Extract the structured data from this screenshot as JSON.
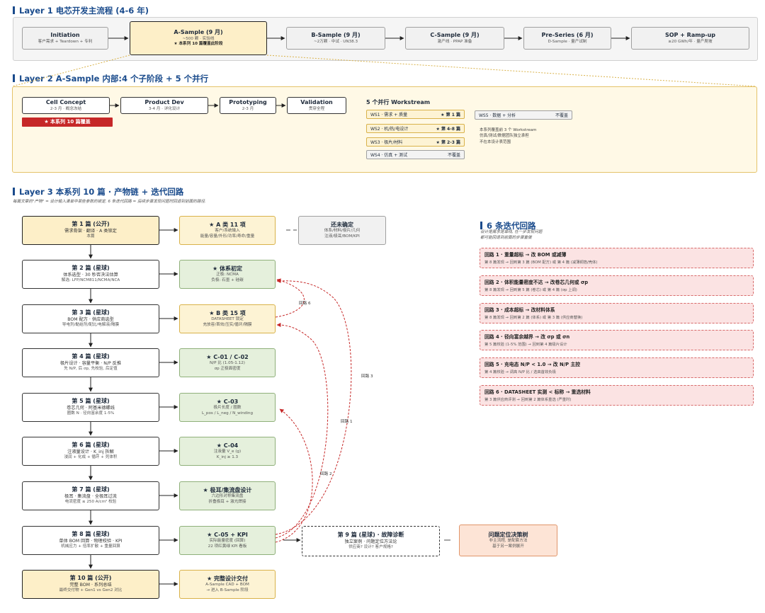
{
  "layer1": {
    "title": "Layer 1 电芯开发主流程 (4-6 年)",
    "stages": [
      {
        "title": "Initiation",
        "sub": "客户需求 + Teardown + 专利",
        "extra": ""
      },
      {
        "title": "A-Sample (9 月)",
        "sub": "~500 颗 · 实验线",
        "extra": "★ 本系列 10 篇覆盖此阶段"
      },
      {
        "title": "B-Sample (9 月)",
        "sub": "~2万颗 · 中试 · UN38.3",
        "extra": ""
      },
      {
        "title": "C-Sample (9 月)",
        "sub": "激产线 · PPAP 准备",
        "extra": ""
      },
      {
        "title": "Pre-Series (6 月)",
        "sub": "D-Sample · 量产试制",
        "extra": ""
      },
      {
        "title": "SOP + Ramp-up",
        "sub": "≥20 GWh/年 · 量产爬坡",
        "extra": ""
      }
    ]
  },
  "layer2": {
    "title": "Layer 2 A-Sample 内部:4 个子阶段 + 5 个并行",
    "phases": [
      {
        "title": "Cell Concept",
        "sub": "2-3 月 · 概念冻结"
      },
      {
        "title": "Product Dev",
        "sub": "3-4 月 · 详化设计"
      },
      {
        "title": "Prototyping",
        "sub": "2-3 月"
      },
      {
        "title": "Validation",
        "sub": "贯穿全程"
      }
    ],
    "coverage_label": "★ 本系列 10 篇覆盖",
    "ws_title": "5 个并行 Workstream",
    "workstreams": [
      {
        "name": "WS1 · 需求 + 质量",
        "tag": "★ 第 1 篇"
      },
      {
        "name": "WS2 · 机/热/电设计",
        "tag": "★ 第 4-8 篇"
      },
      {
        "name": "WS3 · 极片/材料",
        "tag": "★ 第 2-3 篇"
      },
      {
        "name": "WS4 · 仿真 + 测试",
        "tag": "不覆盖"
      },
      {
        "name": "WS5 · 数据 + 分析",
        "tag": "不覆盖"
      }
    ],
    "ws_note": [
      "本系列覆盖前 3 个 Workstream",
      "仿真/测试/数据团队独立承担",
      "不在本设计表范围"
    ]
  },
  "layer3": {
    "title": "Layer 3 本系列 10 篇 · 产物链 + 迭代回路",
    "subtitle": "每篇文章的\"产物\" = 设计输入清单中某些参数的锁定. 6 条迭代回路 = 后续步骤发现问题时回退到前面的路径.",
    "articles": [
      {
        "title": "第 1 篇 (公开)",
        "l2": "需求骨架 · 翻译 · A 类锁定",
        "l3": "本篇"
      },
      {
        "title": "第 2 篇 (星球)",
        "l2": "体系选型 · 30 秒否决法估算",
        "l3": "解选: LFP/NCM811/NCMA/NCA"
      },
      {
        "title": "第 3 篇 (星球)",
        "l2": "BOM 配方 · 供应商选型",
        "l3": "导电剂/黏结剂/配比/电解液/隔膜"
      },
      {
        "title": "第 4 篇 (星球)",
        "l2": "极片设计 · 容量平衡 · N/P 反推",
        "l3": "先 N/P, 后 σp, 先校验, 后定值"
      },
      {
        "title": "第 5 篇 (星球)",
        "l2": "卷芯几何 · 阿基米德螺线",
        "l3": "圈数 N · 径向富余度 1-5%"
      },
      {
        "title": "第 6 篇 (星球)",
        "l2": "注液量设计 · K_inj 拆解",
        "l3": "浸润 + 化成 + 循环 + 死体积"
      },
      {
        "title": "第 7 篇 (星球)",
        "l2": "极耳 · 集流盘 · 全极耳过流",
        "l3": "电流密度 ≤ 250 A/cm² 校验"
      },
      {
        "title": "第 8 篇 (星球)",
        "l2": "单体 BOM 回算 · 物理校验 · KPI",
        "l3": "机械应力 + 倍率扩散 + 重量回算"
      },
      {
        "title": "第 10 篇 (公开)",
        "l2": "完整 BOM · 系列总结",
        "l3": "最终交付物 + Gen1 vs Gen2 对比"
      }
    ],
    "outputs": [
      {
        "title": "★ A 类 11 项",
        "l2": "客户/系统输入",
        "l3": "能量/容量/外形/功率/寿命/重量"
      },
      {
        "title": "★ 体系初定",
        "l2": "正极: NCMA",
        "l3": "负极: 石墨 + 硅碳"
      },
      {
        "title": "★ B 类 15 项",
        "l2": "DATASHEET 锁定",
        "l3": "充放容/首效/压实/循环/隔膜"
      },
      {
        "title": "★ C-01 / C-02",
        "l2": "N/P 比 (1.05-1.12)",
        "l3": "σp 正极面密度"
      },
      {
        "title": "★ C-03",
        "l2": "极片长度 / 圈数",
        "l3": "L_pos / L_neg / N_winding"
      },
      {
        "title": "★ C-04",
        "l2": "注液量 V_e (g)",
        "l3": "K_inj ≥ 1.3"
      },
      {
        "title": "★ 极耳/集流盘设计",
        "l2": "六边形对称集流盘",
        "l3": "折叠极耳 + 激光焊接"
      },
      {
        "title": "★ C-05 + KPI",
        "l2": "实际能量密度 (回算)",
        "l3": "22 项红黄绿 KPI 看板"
      },
      {
        "title": "★ 完整设计交付",
        "l2": "A-Sample CAD + BOM",
        "l3": "→ 进入 B-Sample 阶段"
      }
    ],
    "undecided": {
      "title": "还未确定",
      "l2": "体系/材料/极片/几何",
      "l3": "注液/极耳/BOM/KPI"
    },
    "art9": {
      "title": "第 9 篇 (星球) · 故障诊断",
      "l2": "独立案例 · 问题定位方法论",
      "l3": "供应商? 设计? 客户规格?"
    },
    "decision": {
      "title": "问题定位决策树",
      "l2": "非主流程, 是配套方法",
      "l3": "基于另一案例展开"
    },
    "loop_labels": [
      "回路 6",
      "回路 3",
      "回路 1",
      "回路 2"
    ],
    "loops_title": "6 条迭代回路",
    "loops_sub": [
      "设计是需求是单线, 任一步发现问题",
      "都可能回退到前面的步骤重做"
    ],
    "loops": [
      {
        "title": "回路 1 · 重量超标 → 改 BOM 或减薄",
        "detail": "第 8 篇发现 → 回到第 3 篇 (BOM 配方) 或 第 4 篇 (减薄铜箔/壳体)"
      },
      {
        "title": "回路 2 · 体积能量密度不达 → 改卷芯几何或 σp",
        "detail": "第 8 篇发现 → 回到第 5 篇 (卷芯) 或 第 4 篇 (σp 上调)"
      },
      {
        "title": "回路 3 · 成本超标 → 改材料体系",
        "detail": "第 8 篇发现 → 回到第 2 篇 (体系) 或 第 3 篇 (供应商替换)"
      },
      {
        "title": "回路 4 · 径向富余越界 → 改 σp 或 σn",
        "detail": "第 5 篇校验 (1-5% 范围) → 回到第 4 篇极片设计"
      },
      {
        "title": "回路 5 · 充电态 N/P < 1.0 → 改 N/P 主控",
        "detail": "第 4 篇校验 → 调高 N/P 比 / 选高首效负极"
      },
      {
        "title": "回路 6 · DATASHEET 实测 < 标称 → 重选材料",
        "detail": "第 3 篇供应商评测 → 回到第 2 篇体系重选 (严重时)"
      }
    ]
  },
  "colors": {
    "accent": "#1a4b8c",
    "loop_line": "#c62828",
    "highlight_red": "#c62828"
  }
}
